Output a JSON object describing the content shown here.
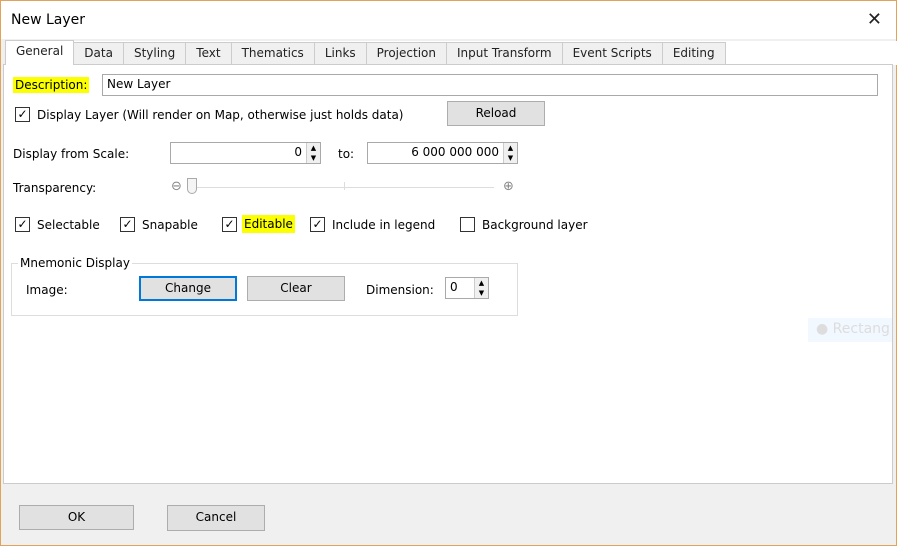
{
  "window": {
    "title": "New Layer"
  },
  "tabs": [
    "General",
    "Data",
    "Styling",
    "Text",
    "Thematics",
    "Links",
    "Projection",
    "Input Transform",
    "Event Scripts",
    "Editing"
  ],
  "general": {
    "description_label": "Description:",
    "description_value": "New Layer",
    "display_layer_label": "Display Layer (Will render on Map, otherwise just holds data)",
    "display_layer_checked": true,
    "reload_label": "Reload",
    "scale_label": "Display from Scale:",
    "scale_from": "0",
    "to_label": "to:",
    "scale_to": "6 000 000 000",
    "transparency_label": "Transparency:",
    "transparency_value": 0,
    "checkboxes": [
      {
        "label": "Selectable",
        "checked": true
      },
      {
        "label": "Snapable",
        "checked": true
      },
      {
        "label": "Editable",
        "checked": true
      },
      {
        "label": "Include in legend",
        "checked": true
      },
      {
        "label": "Background layer",
        "checked": false
      }
    ],
    "mnemonic": {
      "title": "Mnemonic Display",
      "image_label": "Image:",
      "change_label": "Change",
      "clear_label": "Clear",
      "dimension_label": "Dimension:",
      "dimension_value": "0"
    },
    "ghost_item": "Rectang"
  },
  "footer": {
    "ok": "OK",
    "cancel": "Cancel"
  },
  "colors": {
    "highlight": "#fbff00",
    "focus": "#0078d7",
    "border": "#e3a25a"
  }
}
